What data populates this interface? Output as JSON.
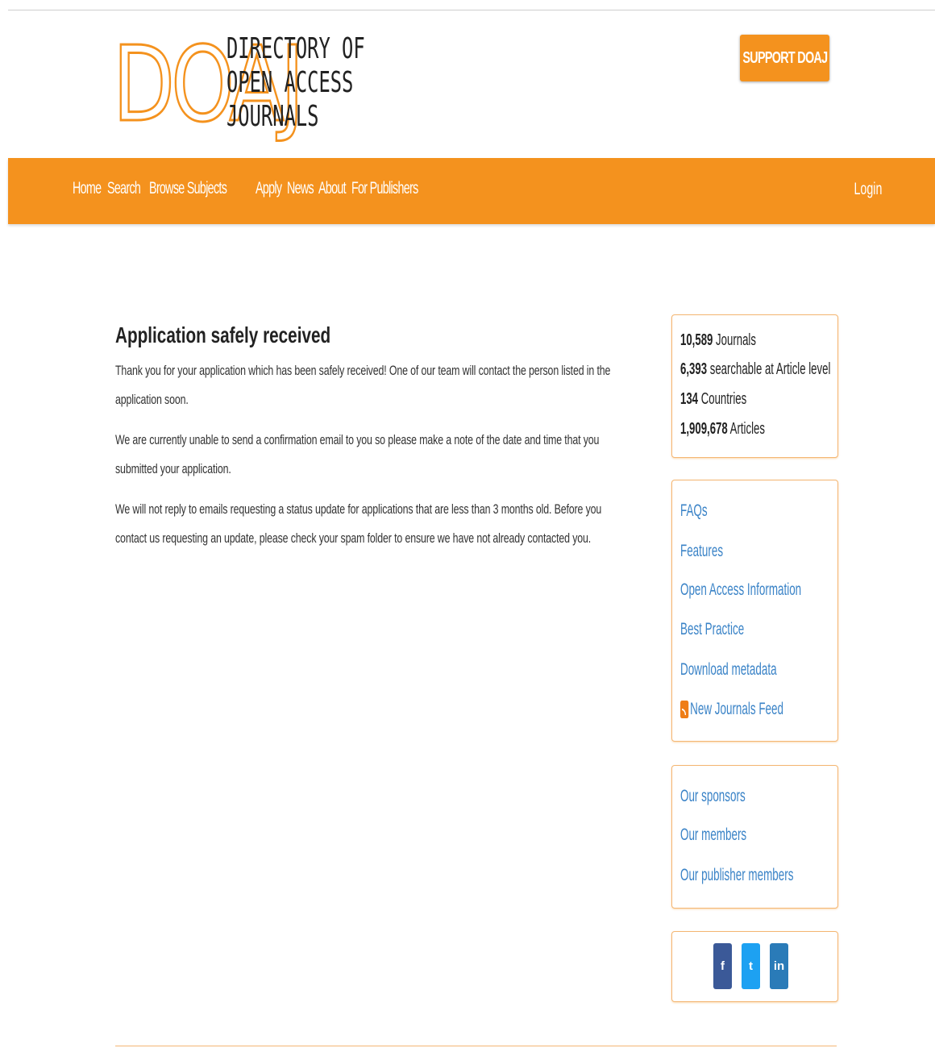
{
  "header": {
    "logo_mark": "DOAJ",
    "logo_lines": [
      "DIRECTORY OF",
      "OPEN ACCESS",
      "JOURNALS"
    ],
    "support_label": "SUPPORT DOAJ"
  },
  "nav": {
    "items": [
      "Home",
      "Search",
      "Browse Subjects",
      "Apply",
      "News",
      "About",
      "For Publishers"
    ],
    "login": "Login"
  },
  "main": {
    "title": "Application safely received",
    "paragraphs": [
      "Thank you for your application which has been safely received! One of our team will contact the person listed in the application soon.",
      "We are currently unable to send a confirmation email to you so please make a note of the date and time that you submitted your application.",
      "We will not reply to emails requesting a status update for applications that are less than 3 months old. Before you contact us requesting an update, please check your spam folder to ensure we have not already contacted you."
    ]
  },
  "stats": {
    "journals_num": "10,589",
    "journals_label": "Journals",
    "searchable_num": "6,393",
    "searchable_label": "searchable at Article level",
    "countries_num": "134",
    "countries_label": "Countries",
    "articles_num": "1,909,678",
    "articles_label": "Articles"
  },
  "sidebar_links": [
    "FAQs",
    "Features",
    "Open Access Information",
    "Best Practice",
    "Download metadata",
    "New Journals Feed"
  ],
  "sidebar_links2": [
    "Our sponsors",
    "Our members",
    "Our publisher members"
  ],
  "social": {
    "facebook": "f",
    "twitter": "t",
    "linkedin": "in"
  },
  "colors": {
    "brand_orange": "#f4921e",
    "link_blue": "#3a83c7"
  }
}
